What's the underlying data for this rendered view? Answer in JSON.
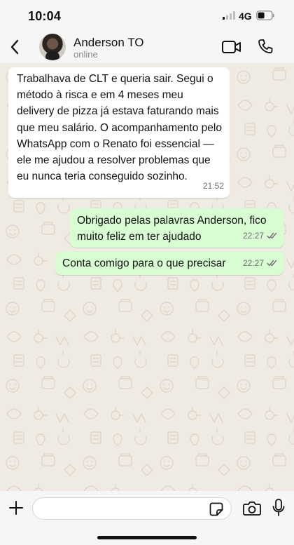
{
  "status_bar": {
    "time": "10:04",
    "network": "4G",
    "icons": [
      "signal-icon",
      "battery-icon"
    ]
  },
  "header": {
    "contact_name": "Anderson TO",
    "contact_status": "online",
    "icons": [
      "back-chevron-icon",
      "video-camera-icon",
      "phone-icon"
    ]
  },
  "messages": [
    {
      "direction": "incoming",
      "text": "Trabalhava de CLT e queria sair. Segui o método à risca e em 4 meses meu delivery de pizza já estava faturando mais que meu salário. O acompanhamento pelo WhatsApp com o Renato foi essencial — ele me ajudou a resolver problemas que eu nunca teria conseguido sozinho.",
      "time": "21:52"
    },
    {
      "direction": "outgoing",
      "text": "Obrigado pelas palavras Anderson, fico muito feliz em ter ajudado",
      "time": "22:27",
      "status": "read"
    },
    {
      "direction": "outgoing",
      "text": "Conta comigo para o que precisar",
      "time": "22:27",
      "status": "read"
    }
  ],
  "input_bar": {
    "value": "",
    "placeholder": "",
    "icons": [
      "plus-icon",
      "sticker-icon",
      "camera-icon",
      "microphone-icon"
    ]
  },
  "colors": {
    "incoming_bubble": "#ffffff",
    "outgoing_bubble": "#d9fdd3",
    "read_ticks": "#6f6f6f",
    "chat_background": "#efeae2"
  }
}
